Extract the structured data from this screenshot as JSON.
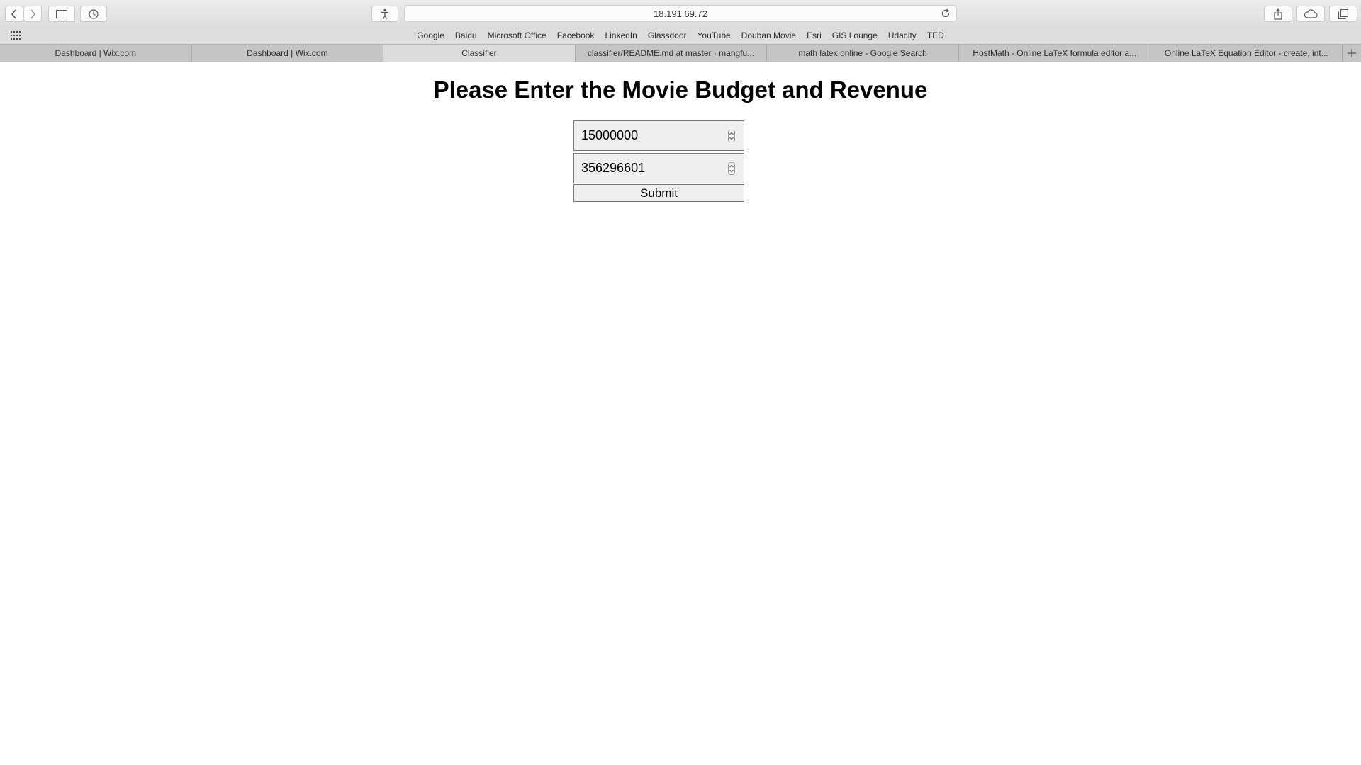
{
  "browser": {
    "url": "18.191.69.72",
    "favorites": [
      "Google",
      "Baidu",
      "Microsoft Office",
      "Facebook",
      "LinkedIn",
      "Glassdoor",
      "YouTube",
      "Douban Movie",
      "Esri",
      "GIS Lounge",
      "Udacity",
      "TED"
    ],
    "tabs": [
      {
        "label": "Dashboard | Wix.com",
        "active": false
      },
      {
        "label": "Dashboard | Wix.com",
        "active": false
      },
      {
        "label": "Classifier",
        "active": true
      },
      {
        "label": "classifier/README.md at master · mangfu...",
        "active": false
      },
      {
        "label": "math latex online - Google Search",
        "active": false
      },
      {
        "label": "HostMath - Online LaTeX formula editor a...",
        "active": false
      },
      {
        "label": "Online LaTeX Equation Editor - create, int...",
        "active": false
      }
    ]
  },
  "page": {
    "title": "Please Enter the Movie Budget and Revenue",
    "budget_value": "15000000",
    "revenue_value": "356296601",
    "submit_label": "Submit"
  }
}
